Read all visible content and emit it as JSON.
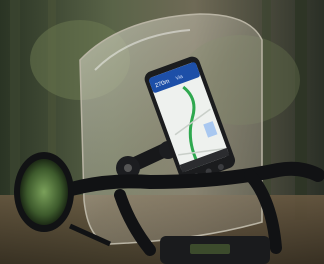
{
  "scene": {
    "description_tag": "photo",
    "phone_screen": {
      "distance": "270m",
      "street": "Via"
    }
  },
  "colors": {
    "forest_dark": "#1f2a1f",
    "forest_mid": "#4d5f3f",
    "forest_light": "#8d8d6d",
    "windscreen_tint": "#c9c4b3",
    "phone_body": "#1b1c1e",
    "map_bg": "#eef1ee",
    "route_green": "#2fa84f",
    "nav_banner": "#1d4fa8",
    "handlebar": "#111214"
  }
}
